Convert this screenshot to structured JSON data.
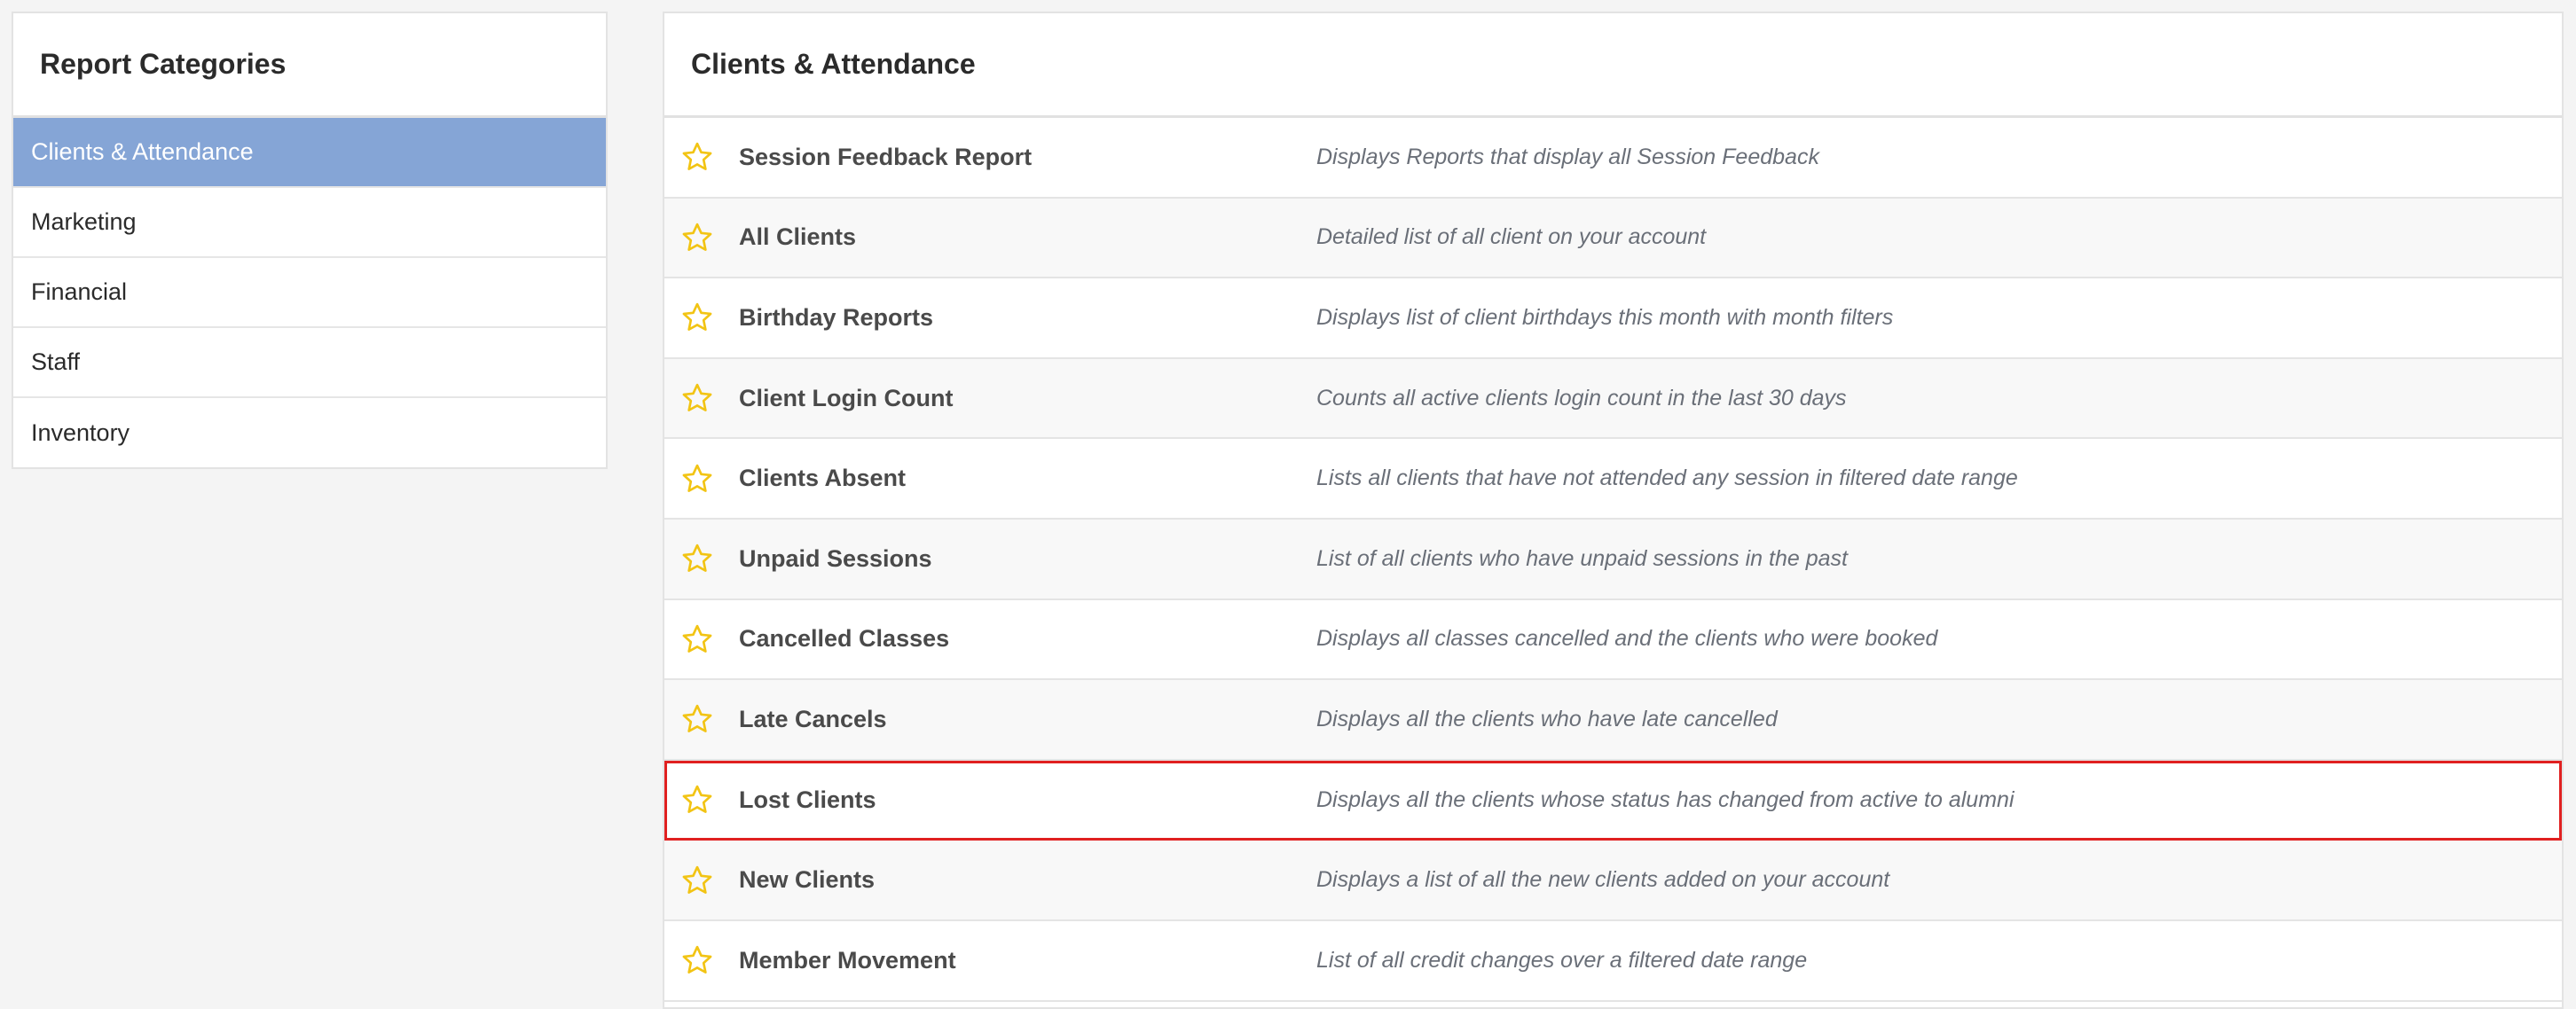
{
  "sidebar": {
    "title": "Report Categories",
    "items": [
      {
        "label": "Clients & Attendance",
        "active": true
      },
      {
        "label": "Marketing",
        "active": false
      },
      {
        "label": "Financial",
        "active": false
      },
      {
        "label": "Staff",
        "active": false
      },
      {
        "label": "Inventory",
        "active": false
      }
    ]
  },
  "main": {
    "title": "Clients & Attendance",
    "reports": [
      {
        "name": "Session Feedback Report",
        "description": "Displays Reports that display all Session Feedback"
      },
      {
        "name": "All Clients",
        "description": "Detailed list of all client on your account"
      },
      {
        "name": "Birthday Reports",
        "description": "Displays list of client birthdays this month with month filters"
      },
      {
        "name": "Client Login Count",
        "description": "Counts all active clients login count in the last 30 days"
      },
      {
        "name": "Clients Absent",
        "description": "Lists all clients that have not attended any session in filtered date range"
      },
      {
        "name": "Unpaid Sessions",
        "description": "List of all clients who have unpaid sessions in the past"
      },
      {
        "name": "Cancelled Classes",
        "description": "Displays all classes cancelled and the clients who were booked"
      },
      {
        "name": "Late Cancels",
        "description": "Displays all the clients who have late cancelled"
      },
      {
        "name": "Lost Clients",
        "description": "Displays all the clients whose status has changed from active to alumni",
        "highlighted": true
      },
      {
        "name": "New Clients",
        "description": "Displays a list of all the new clients added on your account"
      },
      {
        "name": "Member Movement",
        "description": "List of all credit changes over a filtered date range"
      }
    ]
  },
  "icons": {
    "favorite": "star-icon"
  },
  "colors": {
    "active_category_bg": "#85a5d6",
    "star": "#f2c414",
    "highlight_border": "#e02020"
  }
}
